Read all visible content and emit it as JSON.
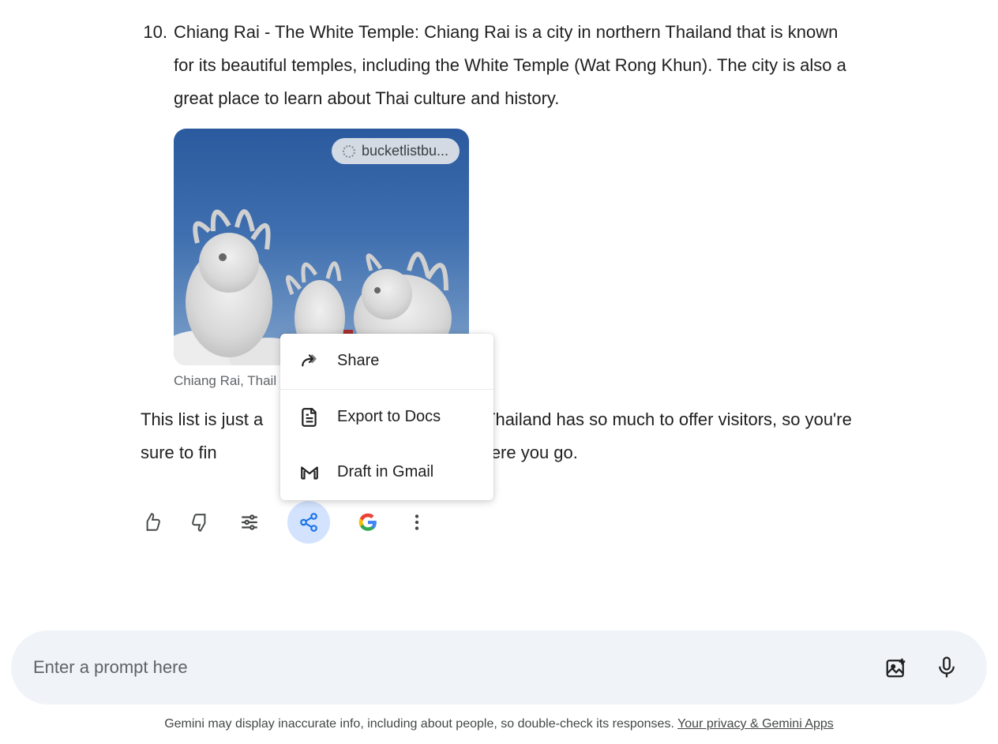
{
  "list": {
    "number": "10.",
    "text": "Chiang Rai - The White Temple: Chiang Rai is a city in northern Thailand that is known for its beautiful temples, including the White Temple (Wat Rong Khun). The city is also a great place to learn about Thai culture and history."
  },
  "image": {
    "source_chip": "bucketlistbu...",
    "caption": "Chiang Rai, Thail"
  },
  "paragraph": "This list is just a                                              Thailand has so much to offer visitors, so you're sure to fin                                          natter where you go.",
  "popup": {
    "share": "Share",
    "export": "Export to Docs",
    "draft": "Draft in Gmail"
  },
  "prompt": {
    "placeholder": "Enter a prompt here"
  },
  "disclaimer": {
    "text": "Gemini may display inaccurate info, including about people, so double-check its responses. ",
    "link": "Your privacy & Gemini Apps"
  }
}
